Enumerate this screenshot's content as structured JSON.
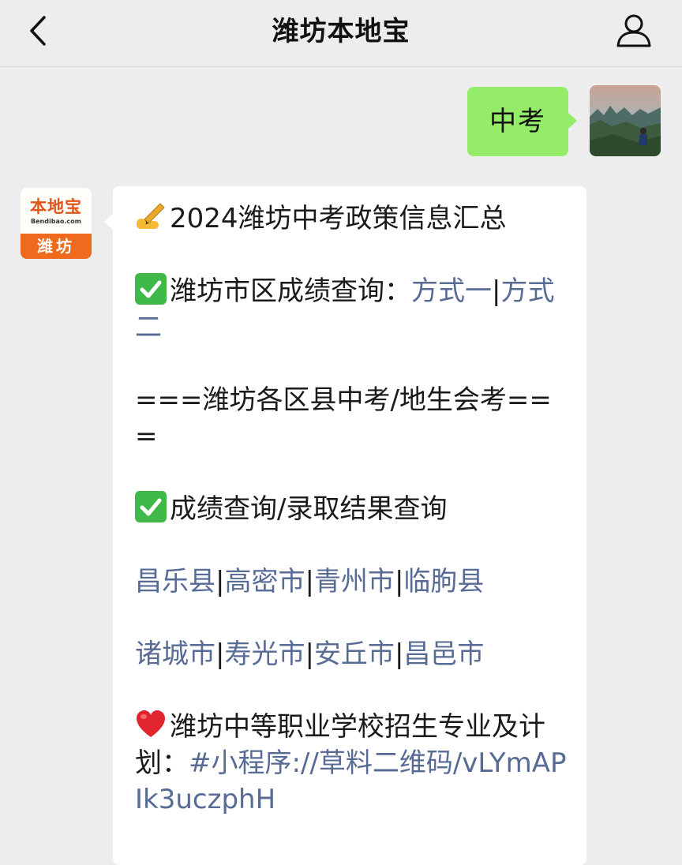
{
  "header": {
    "title": "潍坊本地宝",
    "back_icon": "chevron-left-icon",
    "profile_icon": "person-icon"
  },
  "outgoing": {
    "text": "中考"
  },
  "bot_avatar": {
    "logo_text": "本地宝",
    "logo_sub": "Bendibao.com",
    "logo_city": "潍坊"
  },
  "message": {
    "title": "2024潍坊中考政策信息汇总",
    "score_query_label": "潍坊市区成绩查询：",
    "method1": "方式一",
    "method2": "方式二",
    "divider_line": "===潍坊各区县中考/地生会考===",
    "results_label": "成绩查询/录取结果查询",
    "counties_row1": [
      "昌乐县",
      "高密市",
      "青州市",
      "临朐县"
    ],
    "counties_row2": [
      "诸城市",
      "寿光市",
      "安丘市",
      "昌邑市"
    ],
    "vocational_label": "潍坊中等职业学校招生专业及计划：",
    "vocational_link": "#小程序://草料二维码/vLYmAPIk3uczphH",
    "separator": "|"
  },
  "colors": {
    "background": "#ededed",
    "bubble_green": "#95ec69",
    "link_blue": "#576b95",
    "brand_orange": "#ee6b1e"
  }
}
